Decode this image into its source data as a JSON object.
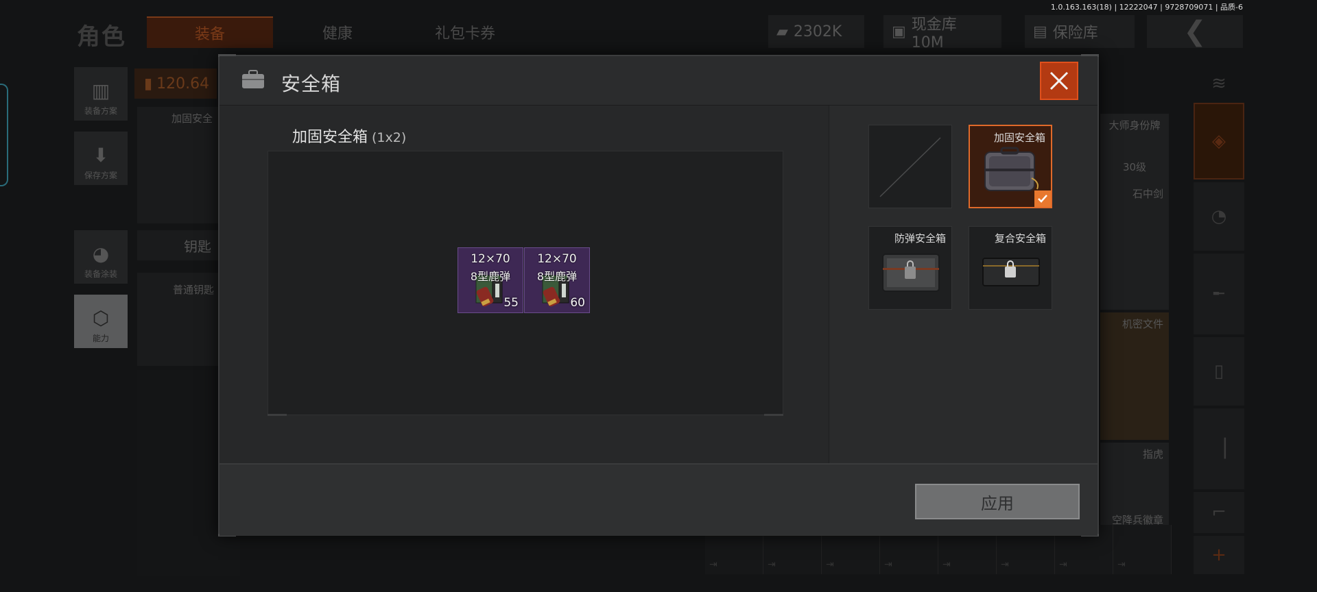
{
  "version_info": "1.0.163.163(18) | 12222047 | 9728709071 | 品质-6",
  "background": {
    "title": "角色",
    "tabs": [
      "装备",
      "健康",
      "礼包卡券"
    ],
    "currency": "2302K",
    "warehouse": "现金库 10M",
    "insurance": "保险库",
    "left_buttons": [
      "装备方案",
      "保存方案",
      "装备涂装",
      "能力"
    ],
    "weight": "120.64",
    "left_card_labels": [
      "加固安全",
      "钥匙",
      "普通钥匙"
    ],
    "right_cards": [
      "大师身份牌",
      "30级",
      "石中剑",
      "机密文件",
      "指虎",
      "空降兵徽章"
    ]
  },
  "modal": {
    "title": "安全箱",
    "case_name": "加固安全箱",
    "case_size": "(1x2)",
    "items": [
      {
        "line1": "12×70",
        "line2": "8型鹿弹",
        "qty": "55"
      },
      {
        "line1": "12×70",
        "line2": "8型鹿弹",
        "qty": "60"
      }
    ],
    "options": [
      {
        "label": "",
        "state": "empty"
      },
      {
        "label": "加固安全箱",
        "state": "selected"
      },
      {
        "label": "防弹安全箱",
        "state": "locked"
      },
      {
        "label": "复合安全箱",
        "state": "locked"
      }
    ],
    "apply_label": "应用"
  },
  "colors": {
    "accent_orange": "#e06a2a",
    "close_bg": "#b33a12",
    "item_purple": "#3e2854"
  }
}
